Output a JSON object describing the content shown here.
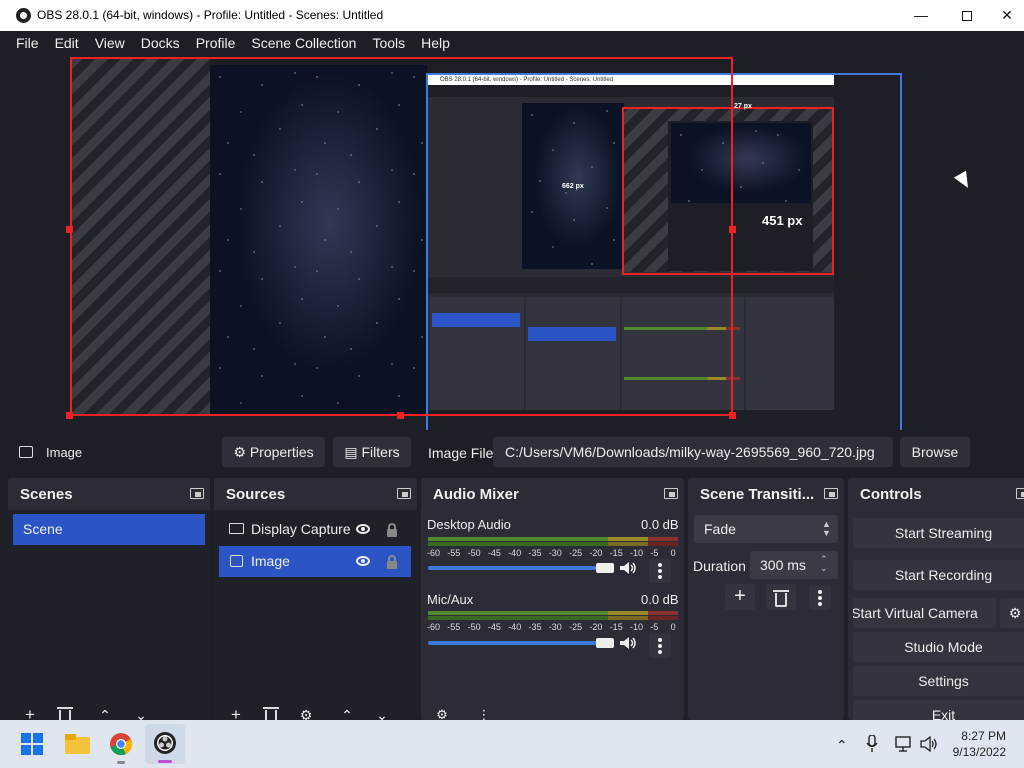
{
  "window": {
    "title": "OBS 28.0.1 (64-bit, windows) - Profile: Untitled - Scenes: Untitled",
    "minimize_icon": "minimize-icon",
    "maximize_icon": "maximize-icon",
    "close_icon": "close-icon"
  },
  "menu": [
    "File",
    "Edit",
    "View",
    "Docks",
    "Profile",
    "Scene Collection",
    "Tools",
    "Help"
  ],
  "preview": {
    "size_label_1": "451 px",
    "size_label_2": "662 px",
    "size_label_3": "27 px",
    "nested_title": "OBS 28.0.1 (64-bit, windows) - Profile: Untitled - Scenes: Untitled"
  },
  "source_toolbar": {
    "source_name": "Image",
    "properties_label": "Properties",
    "filters_label": "Filters",
    "image_file_label": "Image File",
    "image_file_value": "C:/Users/VM6/Downloads/milky-way-2695569_960_720.jpg",
    "browse_label": "Browse"
  },
  "scenes": {
    "title": "Scenes",
    "items": [
      "Scene"
    ]
  },
  "sources": {
    "title": "Sources",
    "items": [
      {
        "label": "Display Capture",
        "icon": "monitor-icon"
      },
      {
        "label": "Image",
        "icon": "image-icon"
      }
    ]
  },
  "mixer": {
    "title": "Audio Mixer",
    "scale": [
      "-60",
      "-55",
      "-50",
      "-45",
      "-40",
      "-35",
      "-30",
      "-25",
      "-20",
      "-15",
      "-10",
      "-5",
      "0"
    ],
    "channels": [
      {
        "name": "Desktop Audio",
        "level": "0.0 dB",
        "volume": 0.96
      },
      {
        "name": "Mic/Aux",
        "level": "0.0 dB",
        "volume": 0.96
      }
    ]
  },
  "transitions": {
    "title": "Scene Transiti...",
    "selected": "Fade",
    "duration_label": "Duration",
    "duration_value": "300 ms"
  },
  "controls": {
    "title": "Controls",
    "start_streaming": "Start Streaming",
    "start_recording": "Start Recording",
    "start_virtual_camera": "Start Virtual Camera",
    "studio_mode": "Studio Mode",
    "settings": "Settings",
    "exit": "Exit"
  },
  "taskbar": {
    "time": "8:27 PM",
    "date": "9/13/2022"
  },
  "colors": {
    "selection_red": "#e22222",
    "selection_blue": "#3f7bdc",
    "selected_item": "#2b54c4"
  }
}
